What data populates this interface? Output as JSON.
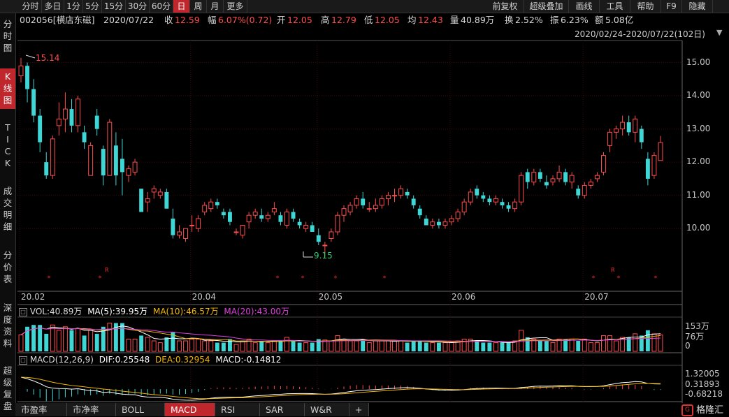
{
  "toolbar": {
    "periods": [
      "分时",
      "多日",
      "1分",
      "5分",
      "15分",
      "30分",
      "60分",
      "日",
      "周",
      "月",
      "更多"
    ],
    "active_period": "日",
    "right_buttons": [
      "前复权",
      "超级叠加",
      "画线",
      "工具",
      "帮助",
      "F9",
      "隐藏"
    ]
  },
  "info": {
    "code": "002056[横店东磁]",
    "date": "2020/07/22",
    "close_label": "收",
    "close": "12.59",
    "change_label": "幅",
    "change": "6.07%(0.72)",
    "open_label": "开",
    "open": "12.05",
    "high_label": "高",
    "high": "12.79",
    "low_label": "低",
    "low": "12.05",
    "avg_label": "均",
    "avg": "12.43",
    "vol_label": "量",
    "volume": "40.89万",
    "turnover_label": "换",
    "turnover": "2.52%",
    "amplitude_label": "振",
    "amplitude": "6.23%",
    "amount_label": "额",
    "amount": "5.08亿"
  },
  "range_label": "2020/02/24-2020/07/22(102日)",
  "left_tabs": [
    "分\n时\n图",
    "K\n线\n图",
    "T\nI\nC\nK",
    "成\n交\n明\n细",
    "分\n价\n表",
    "深\n度\n资\n料",
    "超\n级\n复\n盘"
  ],
  "left_active": "K线图",
  "price_axis": [
    "15.00",
    "14.00",
    "13.00",
    "12.00",
    "11.00",
    "10.00"
  ],
  "date_axis": [
    "20.02",
    "20.04",
    "20.05",
    "20.06",
    "20.07"
  ],
  "annotations": {
    "max": "15.14",
    "min": "9.15"
  },
  "vol_panel": {
    "vol": "VOL:40.89万",
    "ma5": "MA(5):39.95万",
    "ma10": "MA(10):46.57万",
    "ma20": "MA(20):43.00万",
    "axis": [
      "153万",
      "76万",
      "0"
    ]
  },
  "macd_panel": {
    "title": "MACD(12,26,9)",
    "dif": "DIF:0.25548",
    "dea": "DEA:0.32954",
    "macd": "MACD:-0.14812",
    "axis": [
      "1.32005",
      "0.31893",
      "-0.68218"
    ]
  },
  "bottom_tabs": [
    "市盈率",
    "市净率",
    "BOLL",
    "MACD",
    "RSI",
    "SAR",
    "W&R",
    "+"
  ],
  "bottom_active": "MACD",
  "watermark": "格隆汇",
  "colors": {
    "up": "#ff4d4d",
    "down": "#3fd6d6",
    "ma5": "#ffffff",
    "ma10": "#f5b800",
    "ma20": "#e040e0",
    "accent": "#c0272d"
  },
  "chart_data": {
    "type": "candlestick",
    "price_range": [
      9.15,
      15.14
    ],
    "candles": [
      [
        14.6,
        15.14,
        14.4,
        14.9
      ],
      [
        14.9,
        15.0,
        13.8,
        14.2
      ],
      [
        14.2,
        14.5,
        13.2,
        13.4
      ],
      [
        13.4,
        13.6,
        12.3,
        12.6
      ],
      [
        12.0,
        12.3,
        11.5,
        11.6
      ],
      [
        11.6,
        12.8,
        11.5,
        12.7
      ],
      [
        13.1,
        13.8,
        12.8,
        13.3
      ],
      [
        13.3,
        14.1,
        12.9,
        13.6
      ],
      [
        13.6,
        13.9,
        12.9,
        13.1
      ],
      [
        13.1,
        14.0,
        12.9,
        13.9
      ],
      [
        12.9,
        13.1,
        12.4,
        12.6
      ],
      [
        11.6,
        12.6,
        11.6,
        12.5
      ],
      [
        13.4,
        13.6,
        12.8,
        13.0
      ],
      [
        12.4,
        12.5,
        11.3,
        11.6
      ],
      [
        11.6,
        13.3,
        11.6,
        13.2
      ],
      [
        12.5,
        12.9,
        11.3,
        11.6
      ],
      [
        12.1,
        12.7,
        11.0,
        11.7
      ],
      [
        11.6,
        11.9,
        11.4,
        11.8
      ],
      [
        11.7,
        12.1,
        11.6,
        12.0
      ],
      [
        11.2,
        11.2,
        10.5,
        10.5
      ],
      [
        10.8,
        11.1,
        10.5,
        10.9
      ],
      [
        11.1,
        11.3,
        10.9,
        11.2
      ],
      [
        11.0,
        11.2,
        10.9,
        11.1
      ],
      [
        11.1,
        11.2,
        10.6,
        10.6
      ],
      [
        10.3,
        10.6,
        9.7,
        9.8
      ],
      [
        9.8,
        10.1,
        9.7,
        9.9
      ],
      [
        9.7,
        10.0,
        9.6,
        10.0
      ],
      [
        10.1,
        10.4,
        9.9,
        10.1
      ],
      [
        10.0,
        10.4,
        9.9,
        10.3
      ],
      [
        10.5,
        10.8,
        10.4,
        10.7
      ],
      [
        10.6,
        10.9,
        10.5,
        10.8
      ],
      [
        10.8,
        10.9,
        10.6,
        10.7
      ],
      [
        10.5,
        10.6,
        10.3,
        10.4
      ],
      [
        10.5,
        10.6,
        10.1,
        10.2
      ],
      [
        9.9,
        10.0,
        9.8,
        9.9
      ],
      [
        9.8,
        10.1,
        9.7,
        10.1
      ],
      [
        10.2,
        10.5,
        10.0,
        10.4
      ],
      [
        10.4,
        10.6,
        10.3,
        10.5
      ],
      [
        10.4,
        10.6,
        10.2,
        10.3
      ],
      [
        10.3,
        10.5,
        10.2,
        10.4
      ],
      [
        10.5,
        10.8,
        10.4,
        10.6
      ],
      [
        10.4,
        10.5,
        10.1,
        10.2
      ],
      [
        10.1,
        10.6,
        10.0,
        10.5
      ],
      [
        10.5,
        10.6,
        10.2,
        10.3
      ],
      [
        10.2,
        10.3,
        10.0,
        10.1
      ],
      [
        10.0,
        10.2,
        9.9,
        10.1
      ],
      [
        10.1,
        10.2,
        9.9,
        9.9
      ],
      [
        9.8,
        10.0,
        9.5,
        9.6
      ],
      [
        9.5,
        9.6,
        9.15,
        9.5
      ],
      [
        9.7,
        10.0,
        9.6,
        9.9
      ],
      [
        9.9,
        10.5,
        9.8,
        10.4
      ],
      [
        10.4,
        10.7,
        10.2,
        10.6
      ],
      [
        10.5,
        10.8,
        10.4,
        10.7
      ],
      [
        10.7,
        11.0,
        10.6,
        10.9
      ],
      [
        10.9,
        11.1,
        10.6,
        10.7
      ],
      [
        10.6,
        10.8,
        10.5,
        10.6
      ],
      [
        10.6,
        10.9,
        10.5,
        10.7
      ],
      [
        10.7,
        11.0,
        10.6,
        10.9
      ],
      [
        10.9,
        11.1,
        10.7,
        11.0
      ],
      [
        11.0,
        11.2,
        10.8,
        11.0
      ],
      [
        11.0,
        11.3,
        10.9,
        11.2
      ],
      [
        11.1,
        11.2,
        10.9,
        11.0
      ],
      [
        10.9,
        11.0,
        10.6,
        10.7
      ],
      [
        10.6,
        10.7,
        10.3,
        10.4
      ],
      [
        10.3,
        10.4,
        10.1,
        10.1
      ],
      [
        10.1,
        10.3,
        10.0,
        10.2
      ],
      [
        10.2,
        10.3,
        10.0,
        10.1
      ],
      [
        10.1,
        10.3,
        10.0,
        10.2
      ],
      [
        10.2,
        10.4,
        10.1,
        10.3
      ],
      [
        10.3,
        10.6,
        10.2,
        10.5
      ],
      [
        10.5,
        10.9,
        10.4,
        10.8
      ],
      [
        10.8,
        11.2,
        10.7,
        11.1
      ],
      [
        11.2,
        11.3,
        10.9,
        11.0
      ],
      [
        11.0,
        11.1,
        10.8,
        10.9
      ],
      [
        10.9,
        11.0,
        10.7,
        10.8
      ],
      [
        10.8,
        11.0,
        10.7,
        10.9
      ],
      [
        10.8,
        10.9,
        10.6,
        10.7
      ],
      [
        10.7,
        10.8,
        10.5,
        10.6
      ],
      [
        10.6,
        10.9,
        10.5,
        10.8
      ],
      [
        10.8,
        11.7,
        10.7,
        11.6
      ],
      [
        11.7,
        11.8,
        11.2,
        11.4
      ],
      [
        11.4,
        11.8,
        11.3,
        11.7
      ],
      [
        11.7,
        11.8,
        11.4,
        11.5
      ],
      [
        11.4,
        11.6,
        11.2,
        11.3
      ],
      [
        11.4,
        11.6,
        11.3,
        11.5
      ],
      [
        11.5,
        11.9,
        11.4,
        11.7
      ],
      [
        11.7,
        11.8,
        11.3,
        11.4
      ],
      [
        11.4,
        11.7,
        11.2,
        11.6
      ],
      [
        11.2,
        11.3,
        10.9,
        11.0
      ],
      [
        11.0,
        11.4,
        10.9,
        11.3
      ],
      [
        11.3,
        11.5,
        11.2,
        11.4
      ],
      [
        11.5,
        11.7,
        11.4,
        11.6
      ],
      [
        11.7,
        12.3,
        11.6,
        12.2
      ],
      [
        12.5,
        13.0,
        12.3,
        12.9
      ],
      [
        12.9,
        13.1,
        12.7,
        13.0
      ],
      [
        13.0,
        13.4,
        12.8,
        13.2
      ],
      [
        13.2,
        13.4,
        12.8,
        12.9
      ],
      [
        12.9,
        13.4,
        12.6,
        13.3
      ],
      [
        13.0,
        13.1,
        12.4,
        12.6
      ],
      [
        12.1,
        12.3,
        11.3,
        11.5
      ],
      [
        11.6,
        12.3,
        11.5,
        12.2
      ],
      [
        12.05,
        12.79,
        12.05,
        12.59
      ]
    ]
  }
}
